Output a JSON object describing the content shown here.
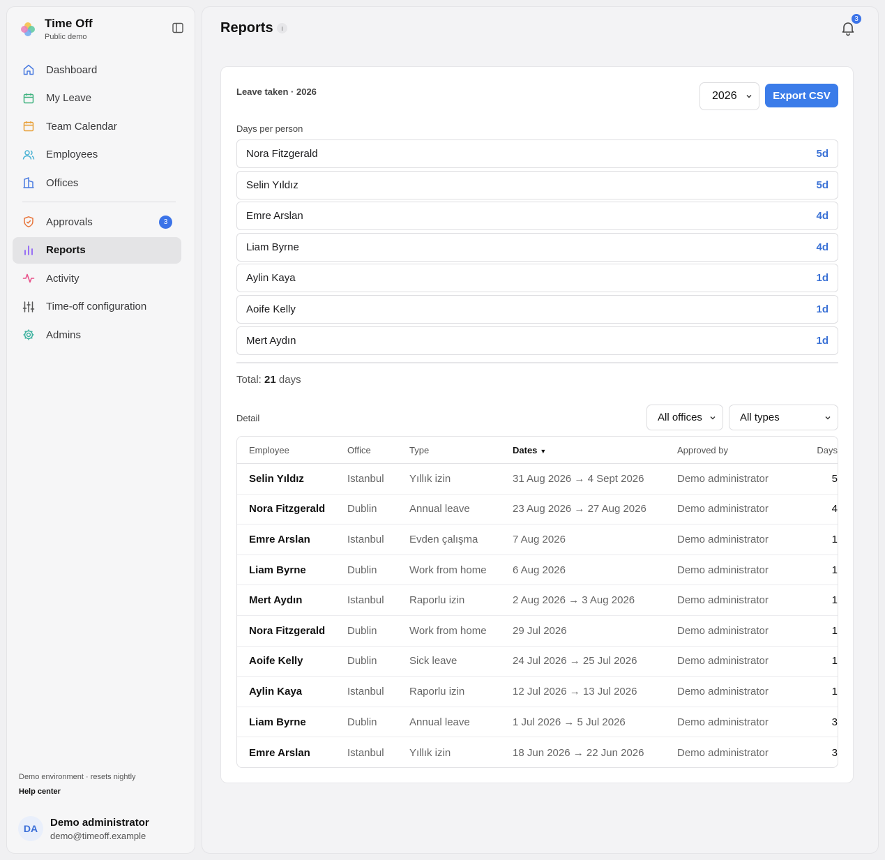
{
  "app": {
    "title": "Time Off",
    "subtitle": "Public demo"
  },
  "sidebar": {
    "items": [
      {
        "label": "Dashboard",
        "icon": "home-icon",
        "color": "#4a7be0"
      },
      {
        "label": "My Leave",
        "icon": "calendar-icon",
        "color": "#3fb27f"
      },
      {
        "label": "Team Calendar",
        "icon": "calendar-icon",
        "color": "#e8a13a"
      },
      {
        "label": "Employees",
        "icon": "users-icon",
        "color": "#4cb3d4"
      },
      {
        "label": "Offices",
        "icon": "building-icon",
        "color": "#4a7be0"
      },
      {
        "label": "Approvals",
        "icon": "shield-icon",
        "color": "#e8743a",
        "badge": "3"
      },
      {
        "label": "Reports",
        "icon": "bar-chart-icon",
        "color": "#8b5cf6",
        "active": true
      },
      {
        "label": "Activity",
        "icon": "activity-icon",
        "color": "#e8508a"
      },
      {
        "label": "Time-off configuration",
        "icon": "sliders-icon",
        "color": "#555555"
      },
      {
        "label": "Admins",
        "icon": "gear-icon",
        "color": "#3fb2a0"
      }
    ],
    "footer_note": "Demo environment · resets nightly",
    "help_label": "Help center",
    "user": {
      "initials": "DA",
      "name": "Demo administrator",
      "email": "demo@timeoff.example"
    }
  },
  "header": {
    "title": "Reports",
    "info_glyph": "i",
    "notifications_count": "3"
  },
  "report": {
    "heading": "Leave taken · 2026",
    "year_value": "2026",
    "export_label": "Export CSV",
    "days_per_person_label": "Days per person",
    "people": [
      {
        "name": "Nora Fitzgerald",
        "days": "5d"
      },
      {
        "name": "Selin Yıldız",
        "days": "5d"
      },
      {
        "name": "Emre Arslan",
        "days": "4d"
      },
      {
        "name": "Liam Byrne",
        "days": "4d"
      },
      {
        "name": "Aylin Kaya",
        "days": "1d"
      },
      {
        "name": "Aoife Kelly",
        "days": "1d"
      },
      {
        "name": "Mert Aydın",
        "days": "1d"
      }
    ],
    "total_prefix": "Total:",
    "total_value": "21",
    "total_suffix": "days",
    "detail_label": "Detail",
    "office_filter": "All offices",
    "type_filter": "All types"
  },
  "table": {
    "headers": {
      "employee": "Employee",
      "office": "Office",
      "type": "Type",
      "dates": "Dates",
      "approved_by": "Approved by",
      "days": "Days"
    },
    "rows": [
      {
        "employee": "Selin Yıldız",
        "office": "Istanbul",
        "type": "Yıllık izin",
        "dates": "31 Aug 2026 → 4 Sept 2026",
        "approved_by": "Demo administrator",
        "days": "5"
      },
      {
        "employee": "Nora Fitzgerald",
        "office": "Dublin",
        "type": "Annual leave",
        "dates": "23 Aug 2026 → 27 Aug 2026",
        "approved_by": "Demo administrator",
        "days": "4"
      },
      {
        "employee": "Emre Arslan",
        "office": "Istanbul",
        "type": "Evden çalışma",
        "dates": "7 Aug 2026",
        "approved_by": "Demo administrator",
        "days": "1"
      },
      {
        "employee": "Liam Byrne",
        "office": "Dublin",
        "type": "Work from home",
        "dates": "6 Aug 2026",
        "approved_by": "Demo administrator",
        "days": "1"
      },
      {
        "employee": "Mert Aydın",
        "office": "Istanbul",
        "type": "Raporlu izin",
        "dates": "2 Aug 2026 → 3 Aug 2026",
        "approved_by": "Demo administrator",
        "days": "1"
      },
      {
        "employee": "Nora Fitzgerald",
        "office": "Dublin",
        "type": "Work from home",
        "dates": "29 Jul 2026",
        "approved_by": "Demo administrator",
        "days": "1"
      },
      {
        "employee": "Aoife Kelly",
        "office": "Dublin",
        "type": "Sick leave",
        "dates": "24 Jul 2026 → 25 Jul 2026",
        "approved_by": "Demo administrator",
        "days": "1"
      },
      {
        "employee": "Aylin Kaya",
        "office": "Istanbul",
        "type": "Raporlu izin",
        "dates": "12 Jul 2026 → 13 Jul 2026",
        "approved_by": "Demo administrator",
        "days": "1"
      },
      {
        "employee": "Liam Byrne",
        "office": "Dublin",
        "type": "Annual leave",
        "dates": "1 Jul 2026 → 5 Jul 2026",
        "approved_by": "Demo administrator",
        "days": "3"
      },
      {
        "employee": "Emre Arslan",
        "office": "Istanbul",
        "type": "Yıllık izin",
        "dates": "18 Jun 2026 → 22 Jun 2026",
        "approved_by": "Demo administrator",
        "days": "3"
      }
    ]
  },
  "colors": {
    "accent": "#3b7ce9",
    "badge": "#3b73e8",
    "days_link": "#3b72d6"
  }
}
